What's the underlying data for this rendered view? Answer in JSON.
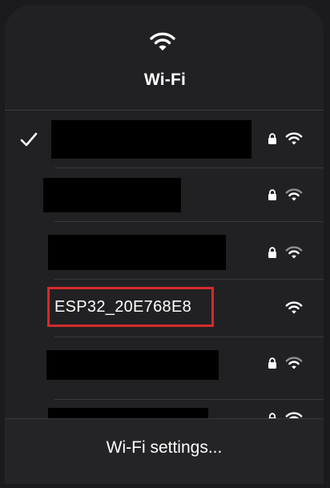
{
  "header": {
    "title": "Wi-Fi",
    "icon": "wifi-icon"
  },
  "networks": [
    {
      "ssid": "",
      "connected": true,
      "locked": true,
      "signal": "full"
    },
    {
      "ssid": "",
      "connected": false,
      "locked": true,
      "signal": "partial"
    },
    {
      "ssid": "",
      "connected": false,
      "locked": true,
      "signal": "partial"
    },
    {
      "ssid": "ESP32_20E768E8",
      "connected": false,
      "locked": false,
      "signal": "full",
      "highlighted": true
    },
    {
      "ssid": "",
      "connected": false,
      "locked": true,
      "signal": "partial"
    },
    {
      "ssid": "",
      "connected": false,
      "locked": true,
      "signal": "full"
    }
  ],
  "footer": {
    "settings_label": "Wi-Fi settings..."
  },
  "colors": {
    "panel_bg": "#212124",
    "highlight_border": "#d42b2b",
    "icon_full": "#ffffff",
    "icon_partial": "#8e8e93"
  }
}
